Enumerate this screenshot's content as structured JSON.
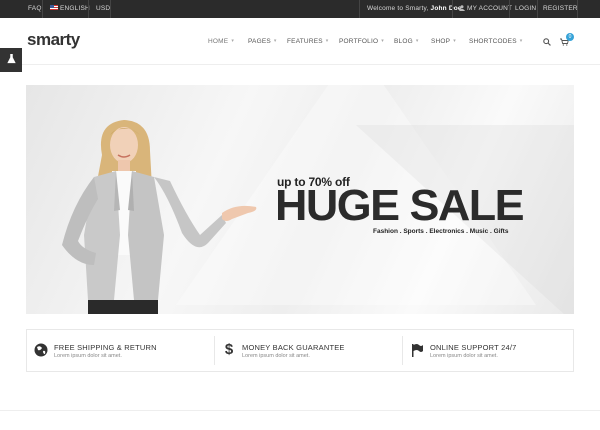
{
  "topbar": {
    "faq": "FAQ",
    "language": "ENGLISH",
    "currency": "USD",
    "welcome_prefix": "Welcome to Smarty,",
    "welcome_user": "John Doe",
    "my_account": "MY ACCOUNT",
    "login": "LOGIN",
    "register": "REGISTER"
  },
  "header": {
    "logo": "smarty",
    "nav": [
      "HOME",
      "PAGES",
      "FEATURES",
      "PORTFOLIO",
      "BLOG",
      "SHOP",
      "SHORTCODES"
    ],
    "cart_count": "0"
  },
  "hero": {
    "small": "up to 70% off",
    "big": "HUGE SALE",
    "sub": "Fashion . Sports . Electronics . Music . Gifts"
  },
  "features": [
    {
      "icon": "globe-icon",
      "title": "FREE SHIPPING & RETURN",
      "desc": "Lorem ipsum dolor sit amet."
    },
    {
      "icon": "dollar-icon",
      "title": "MONEY BACK GUARANTEE",
      "desc": "Lorem ipsum dolor sit amet."
    },
    {
      "icon": "flag-icon",
      "title": "ONLINE SUPPORT 24/7",
      "desc": "Lorem ipsum dolor sit amet."
    }
  ],
  "colors": {
    "topbar": "#2b2b2b",
    "badge": "#36a3d8",
    "text": "#333333"
  }
}
